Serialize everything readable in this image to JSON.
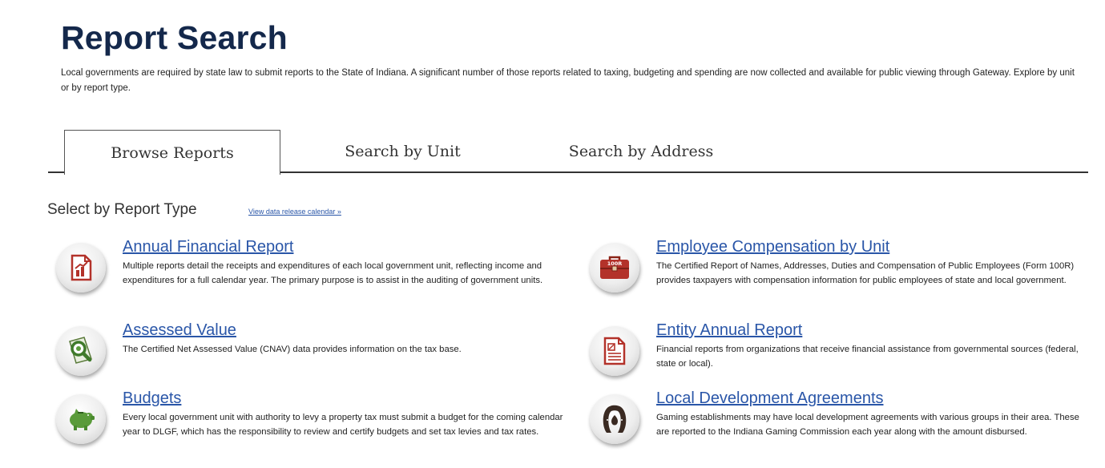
{
  "page": {
    "title": "Report Search",
    "intro": "Local governments are required by state law to submit reports to the State of Indiana. A significant number of those reports related to taxing, budgeting and spending are now collected and available for public viewing through Gateway. Explore by unit or by report type."
  },
  "tabs": [
    {
      "label": "Browse Reports",
      "active": true
    },
    {
      "label": "Search by Unit",
      "active": false
    },
    {
      "label": "Search by Address",
      "active": false
    }
  ],
  "section": {
    "heading": "Select by Report Type",
    "calendar_link": "View data release calendar »"
  },
  "reports": {
    "annual_financial": {
      "title": "Annual Financial Report",
      "description": "Multiple reports detail the receipts and expenditures of each local government unit, reflecting income and expenditures for a full calendar year. The primary purpose is to assist in the auditing of government units.",
      "icon": "financial-report-icon"
    },
    "assessed_value": {
      "title": "Assessed Value",
      "description": "The Certified Net Assessed Value (CNAV) data provides information on the tax base.",
      "icon": "magnifier-icon"
    },
    "budgets": {
      "title": "Budgets",
      "description": "Every local government unit with authority to levy a property tax must submit a budget for the coming calendar year to DLGF, which has the responsibility to review and certify budgets and set tax levies and tax rates.",
      "icon": "piggy-bank-icon"
    },
    "employee_comp": {
      "title": "Employee Compensation by Unit",
      "description": "The Certified Report of Names, Addresses, Duties and Compensation of Public Employees (Form 100R) provides taxpayers with compensation information for public employees of state and local government.",
      "icon": "briefcase-icon",
      "icon_text": "100R"
    },
    "entity_annual": {
      "title": "Entity Annual Report",
      "description": "Financial reports from organizations that receive financial assistance from governmental sources (federal, state or local).",
      "icon": "document-icon"
    },
    "local_dev": {
      "title": "Local Development Agreements",
      "description": "Gaming establishments may have local development agreements with various groups in their area. These are reported to the Indiana Gaming Commission each year along with the amount disbursed.",
      "icon": "horseshoe-icon"
    }
  },
  "colors": {
    "title": "#14284b",
    "link": "#2a56a8",
    "icon_red": "#b3322a",
    "icon_green": "#5a9b3a"
  }
}
